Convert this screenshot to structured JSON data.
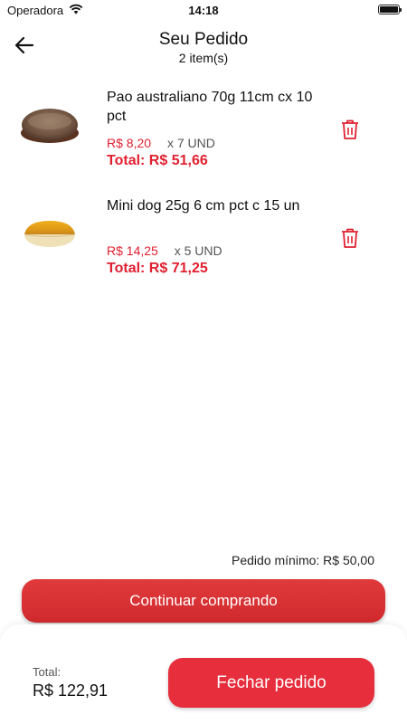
{
  "status_bar": {
    "carrier": "Operadora",
    "time": "14:18",
    "wifi_icon": "wifi-icon",
    "battery_icon": "battery-icon"
  },
  "header": {
    "title": "Seu Pedido",
    "subtitle": "2 item(s)",
    "back_icon": "arrow-left-icon"
  },
  "items": [
    {
      "name": "Pao australiano 70g 11cm cx 10 pct",
      "unit_price": "R$ 8,20",
      "quantity": "x  7 UND",
      "total": "Total: R$ 51,66",
      "image_icon": "bread-roll-image",
      "delete_icon": "trash-icon"
    },
    {
      "name": "Mini dog  25g 6 cm pct c 15 un",
      "unit_price": "R$ 14,25",
      "quantity": "x  5 UND",
      "total": "Total: R$ 71,25",
      "image_icon": "hot-dog-bun-image",
      "delete_icon": "trash-icon"
    }
  ],
  "min_order": "Pedido mínimo: R$ 50,00",
  "continue_button": "Continuar comprando",
  "footer": {
    "total_label": "Total:",
    "total_value": "R$ 122,91",
    "checkout_button": "Fechar pedido"
  },
  "colors": {
    "accent": "#e02030",
    "button": "#e62e3c"
  }
}
